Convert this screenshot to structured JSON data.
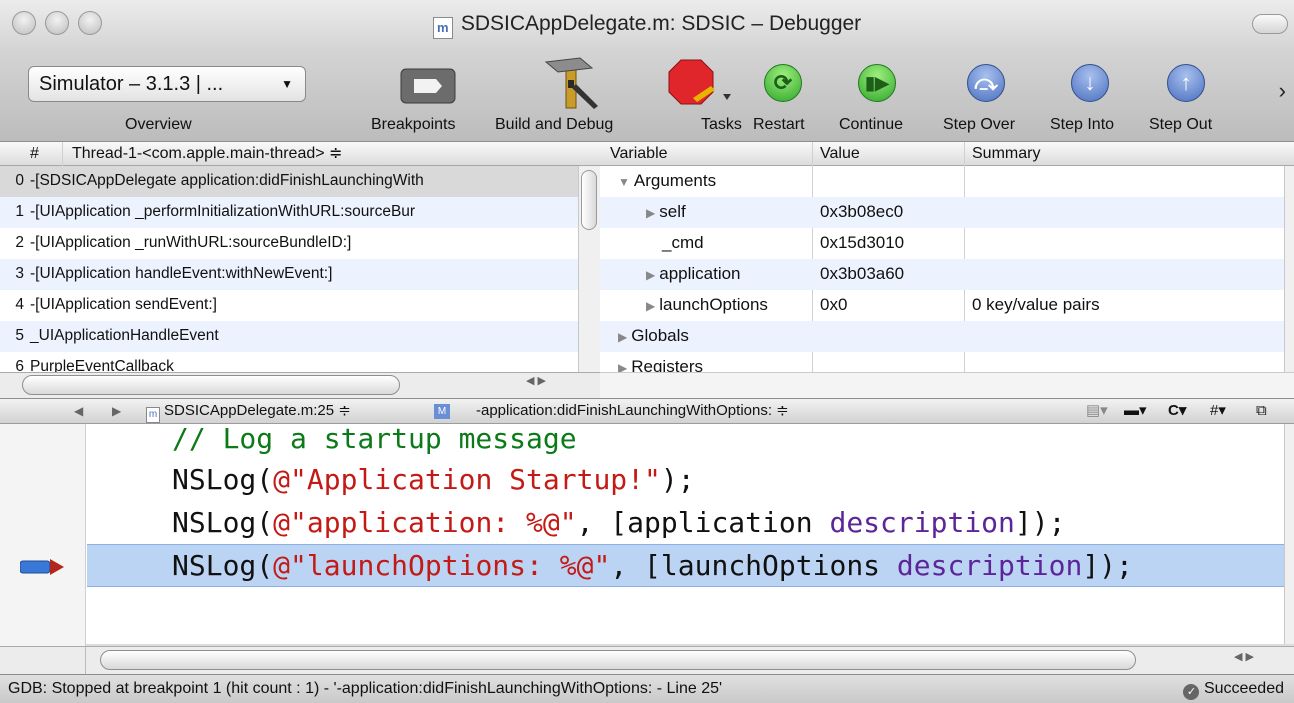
{
  "window": {
    "title": "SDSICAppDelegate.m: SDSIC – Debugger",
    "doc_icon_letter": "m"
  },
  "toolbar": {
    "overview_value": "Simulator – 3.1.3 | ...",
    "overview_label": "Overview",
    "breakpoints_label": "Breakpoints",
    "build_debug_label": "Build and Debug",
    "tasks_label": "Tasks",
    "restart_label": "Restart",
    "continue_label": "Continue",
    "step_over_label": "Step Over",
    "step_into_label": "Step Into",
    "step_out_label": "Step Out",
    "more_glyph": "›"
  },
  "stack": {
    "col_num": "#",
    "thread": "Thread-1-<com.apple.main-thread> ≑",
    "frames": [
      {
        "n": "0",
        "label": "-[SDSICAppDelegate application:didFinishLaunchingWith"
      },
      {
        "n": "1",
        "label": "-[UIApplication _performInitializationWithURL:sourceBur"
      },
      {
        "n": "2",
        "label": "-[UIApplication _runWithURL:sourceBundleID:]"
      },
      {
        "n": "3",
        "label": "-[UIApplication handleEvent:withNewEvent:]"
      },
      {
        "n": "4",
        "label": "-[UIApplication sendEvent:]"
      },
      {
        "n": "5",
        "label": "_UIApplicationHandleEvent"
      },
      {
        "n": "6",
        "label": "PurpleEventCallback"
      }
    ]
  },
  "variables": {
    "col_variable": "Variable",
    "col_value": "Value",
    "col_summary": "Summary",
    "rows": [
      {
        "name": "Arguments",
        "value": "",
        "summary": ""
      },
      {
        "name": "self",
        "value": "0x3b08ec0",
        "summary": ""
      },
      {
        "name": "_cmd",
        "value": "0x15d3010",
        "summary": ""
      },
      {
        "name": "application",
        "value": "0x3b03a60",
        "summary": ""
      },
      {
        "name": "launchOptions",
        "value": "0x0",
        "summary": "0 key/value pairs"
      },
      {
        "name": "Globals",
        "value": "",
        "summary": ""
      },
      {
        "name": "Registers",
        "value": "",
        "summary": ""
      }
    ]
  },
  "editor": {
    "file_popup": "SDSICAppDelegate.m:25 ≑",
    "method_icon_letter": "M",
    "method_popup": "-application:didFinishLaunchingWithOptions: ≑",
    "nav_c": "C",
    "nav_hash": "#",
    "lines": {
      "l1_comment": "// Log a startup message",
      "l2_a": "NSLog(",
      "l2_str": "@\"Application Startup!\"",
      "l2_b": ");",
      "l3_a": "NSLog(",
      "l3_str": "@\"application: %@\"",
      "l3_b": ", [application ",
      "l3_meth": "description",
      "l3_c": "]);",
      "l4_a": "NSLog(",
      "l4_str": "@\"launchOptions: %@\"",
      "l4_b": ", [launchOptions ",
      "l4_meth": "description",
      "l4_c": "]);"
    }
  },
  "status": {
    "message": "GDB: Stopped at breakpoint 1 (hit count : 1) - '-application:didFinishLaunchingWithOptions: - Line 25'",
    "result": "Succeeded"
  },
  "colors": {
    "selection": "#bcd4f4",
    "string": "#c41a16",
    "comment": "#0c7a18",
    "method": "#5c2699"
  }
}
